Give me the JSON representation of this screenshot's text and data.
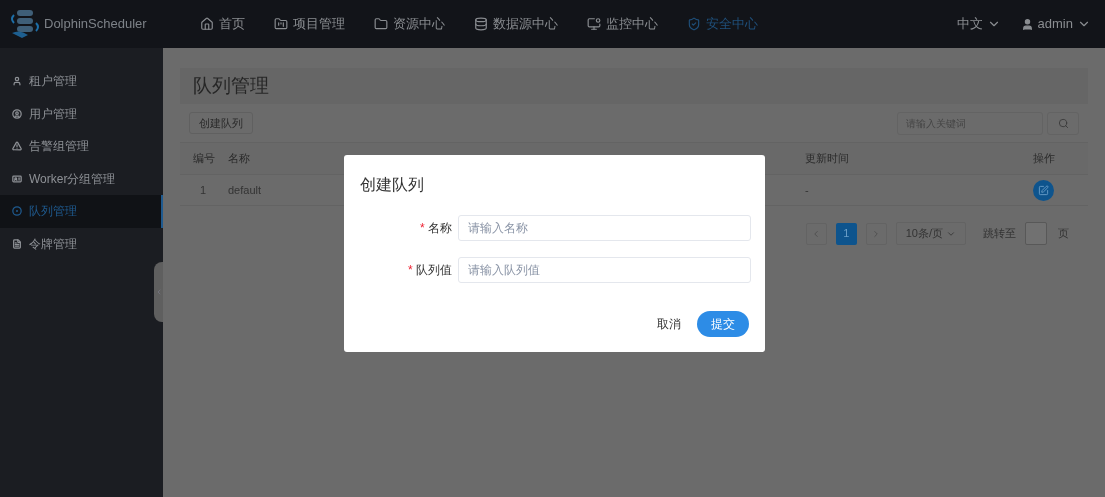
{
  "header": {
    "logo_text": "DolphinScheduler",
    "nav": [
      {
        "label": "首页",
        "selected": false
      },
      {
        "label": "项目管理",
        "selected": false
      },
      {
        "label": "资源中心",
        "selected": false
      },
      {
        "label": "数据源中心",
        "selected": false
      },
      {
        "label": "监控中心",
        "selected": false
      },
      {
        "label": "安全中心",
        "selected": true
      }
    ],
    "language": "中文",
    "user": "admin"
  },
  "sidebar": {
    "items": [
      {
        "label": "租户管理",
        "selected": false
      },
      {
        "label": "用户管理",
        "selected": false
      },
      {
        "label": "告警组管理",
        "selected": false
      },
      {
        "label": "Worker分组管理",
        "selected": false
      },
      {
        "label": "队列管理",
        "selected": true
      },
      {
        "label": "令牌管理",
        "selected": false
      }
    ]
  },
  "page": {
    "title": "队列管理",
    "create_button": "创建队列",
    "search": {
      "placeholder": "请输入关键词"
    },
    "table": {
      "columns": [
        "编号",
        "名称",
        "更新时间",
        "操作"
      ],
      "rows": [
        {
          "index": "1",
          "name": "default",
          "updated": "-"
        }
      ]
    },
    "pagination": {
      "pages": [
        {
          "label": "1",
          "selected": true
        }
      ],
      "page_size": "10条/页",
      "jump_label": "跳转至",
      "page_suffix": "页"
    }
  },
  "dialog": {
    "title": "创建队列",
    "fields": [
      {
        "label": "名称",
        "required_mark": "*",
        "placeholder": "请输入名称"
      },
      {
        "label": "队列值",
        "required_mark": "*",
        "placeholder": "请输入队列值"
      }
    ],
    "cancel": "取消",
    "submit": "提交"
  }
}
